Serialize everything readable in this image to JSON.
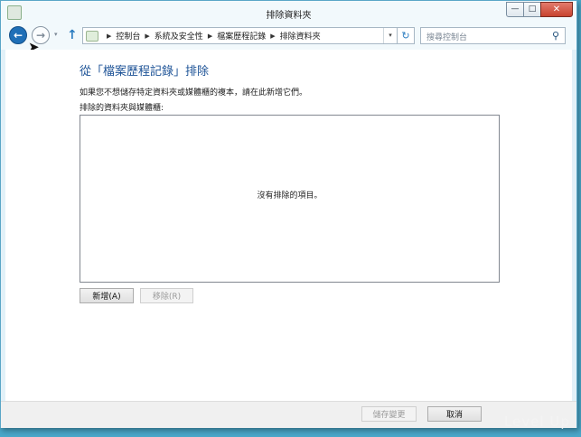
{
  "window": {
    "title": "排除資料夾",
    "minimize_symbol": "—",
    "maximize_symbol": "□",
    "close_symbol": "✕"
  },
  "nav": {
    "back_symbol": "←",
    "forward_symbol": "→",
    "recent_symbol": "▾",
    "up_symbol": "↑",
    "breadcrumbs": [
      "控制台",
      "系統及安全性",
      "檔案歷程記錄",
      "排除資料夾"
    ],
    "breadcrumb_separator": "▶",
    "address_dropdown_symbol": "▾",
    "refresh_symbol": "↻",
    "search_placeholder": "搜尋控制台",
    "search_symbol": "⚲"
  },
  "main": {
    "heading": "從「檔案歷程記錄」排除",
    "description": "如果您不想儲存特定資料夾或媒體櫃的複本，請在此新增它們。",
    "list_label": "排除的資料夾與媒體櫃:",
    "empty_text": "沒有排除的項目。",
    "add_button": "新增(A)",
    "remove_button": "移除(R)"
  },
  "footer": {
    "save_button": "儲存變更",
    "cancel_button": "取消"
  },
  "watermark": "Level Up",
  "colors": {
    "heading": "#1c5296",
    "back_button": "#1f6fb7",
    "chrome": "#e2f1f8"
  }
}
